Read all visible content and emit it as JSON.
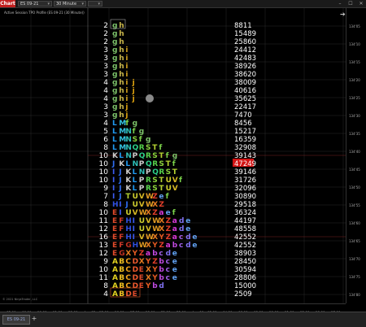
{
  "toolbar": {
    "chart_tab": "Chart",
    "instrument": "ES 09-21",
    "interval": "30 Minute",
    "template": "",
    "window_controls": [
      "–",
      "☐",
      "✕"
    ]
  },
  "chart_title": "Active Session TPO Profile (ES 09-21 (30 Minute))",
  "copyright": "© 2021 NinjaTrader, LLC",
  "bottom_tab": "ES 09-21",
  "colors": {
    "background": "#000000",
    "grid": "#2a2a2a",
    "count_text": "#ffffff",
    "poc_highlight": "#d21414",
    "letter_colors": {
      "g": "#7dc36a",
      "h": "#c8b54a",
      "i": "#d3a21c",
      "j": "#e2a50f",
      "k": "#f0a41a",
      "L": "#1f9af1",
      "M": "#34c2e0",
      "N": "#2ec0b8",
      "Q": "#2bd18a",
      "R": "#55d04a",
      "S": "#8ad23c",
      "T": "#b5d232",
      "f": "#7ad14a",
      "U": "#cfcf2e",
      "V": "#d7b824",
      "W": "#e09a22",
      "X": "#e47a20",
      "Y": "#e35a22",
      "Z": "#e23e2a",
      "J": "#2e6cf0",
      "I": "#3b5cf2",
      "H": "#2f4fe0",
      "G": "#c03020",
      "F": "#d03a2a",
      "E": "#e04a2a",
      "D": "#f05a2e",
      "C": "#f2a21a",
      "B": "#f0c020",
      "A": "#e0d020",
      "a": "#d83ad8",
      "b": "#c04ae0",
      "c": "#a060e8",
      "d": "#8070f0",
      "e": "#60a0f0"
    }
  },
  "chart_data": {
    "type": "table",
    "title": "",
    "price_labels": [
      "134'05",
      "134'10",
      "134'15",
      "134'20",
      "134'25",
      "134'30",
      "134'35",
      "134'40",
      "134'45",
      "134'50",
      "134'55",
      "134'60",
      "134'65",
      "134'70",
      "134'75",
      "134'80"
    ],
    "x_ticks": [
      "05:00",
      "06:00",
      "10:00",
      "11:00",
      "13:00",
      "Aug 05",
      "15:00",
      "16:00",
      "17:00",
      "18:00",
      "21:00",
      "22:00",
      "Aug 06",
      "02:00",
      "04:00",
      "06:00",
      "08:00",
      "10:00",
      "11:00",
      "13:00",
      "18:00",
      "17:00"
    ],
    "rows": [
      {
        "tpo_count": "2",
        "letters": "gh",
        "volume": "8811"
      },
      {
        "tpo_count": "2",
        "letters": "gh",
        "volume": "15489"
      },
      {
        "tpo_count": "2",
        "letters": "gh",
        "volume": "25860"
      },
      {
        "tpo_count": "3",
        "letters": "ghi",
        "volume": "24412"
      },
      {
        "tpo_count": "3",
        "letters": "ghi",
        "volume": "42483"
      },
      {
        "tpo_count": "3",
        "letters": "ghi",
        "volume": "38926"
      },
      {
        "tpo_count": "3",
        "letters": "ghi",
        "volume": "38620"
      },
      {
        "tpo_count": "4",
        "letters": "ghij",
        "volume": "38009"
      },
      {
        "tpo_count": "4",
        "letters": "ghij",
        "volume": "40616"
      },
      {
        "tpo_count": "4",
        "letters": "ghij",
        "volume": "35625"
      },
      {
        "tpo_count": "3",
        "letters": "ghj",
        "volume": "22417"
      },
      {
        "tpo_count": "3",
        "letters": "ghj",
        "volume": "7470"
      },
      {
        "tpo_count": "4",
        "letters": "LMfg",
        "volume": "8456"
      },
      {
        "tpo_count": "5",
        "letters": "LMNfg",
        "volume": "15217"
      },
      {
        "tpo_count": "6",
        "letters": "LMNSfg",
        "volume": "16359"
      },
      {
        "tpo_count": "8",
        "letters": "LMNQRSTf",
        "volume": "32908"
      },
      {
        "tpo_count": "10",
        "letters": "KLNPQRSTfg",
        "volume": "39143"
      },
      {
        "tpo_count": "10",
        "letters": "JKLNPQRSTf",
        "volume": "47249"
      },
      {
        "tpo_count": "10",
        "letters": "IJKLNPQRST",
        "volume": "39146"
      },
      {
        "tpo_count": "10",
        "letters": "IJKLPRSTUVf",
        "volume": "31726"
      },
      {
        "tpo_count": "9",
        "letters": "IJKLPRSTUV",
        "volume": "32096"
      },
      {
        "tpo_count": "7",
        "letters": "IJTUVWZef",
        "volume": "30890"
      },
      {
        "tpo_count": "8",
        "letters": "HIJUVWXZ",
        "volume": "29518"
      },
      {
        "tpo_count": "10",
        "letters": "EIUVWXZaef",
        "volume": "36324"
      },
      {
        "tpo_count": "11",
        "letters": "EFHIUVWXZade",
        "volume": "44197"
      },
      {
        "tpo_count": "12",
        "letters": "EFHIUVWXZade",
        "volume": "48558"
      },
      {
        "tpo_count": "16",
        "letters": "EFHIVWXYZacde",
        "volume": "42552"
      },
      {
        "tpo_count": "13",
        "letters": "EFGHWXYZabcde",
        "volume": "42552"
      },
      {
        "tpo_count": "12",
        "letters": "EGXYZabcde",
        "volume": "38903"
      },
      {
        "tpo_count": "9",
        "letters": "ABCDXYZbce",
        "volume": "28450"
      },
      {
        "tpo_count": "10",
        "letters": "ABCDEXYbce",
        "volume": "30594"
      },
      {
        "tpo_count": "11",
        "letters": "ABCDEXYbce",
        "volume": "28806"
      },
      {
        "tpo_count": "8",
        "letters": "ABCDEYbd",
        "volume": "15000"
      },
      {
        "tpo_count": "4",
        "letters": "ABDE",
        "volume": "2509"
      }
    ],
    "poc_row_index": 17,
    "level_lines": [
      16,
      26
    ]
  }
}
